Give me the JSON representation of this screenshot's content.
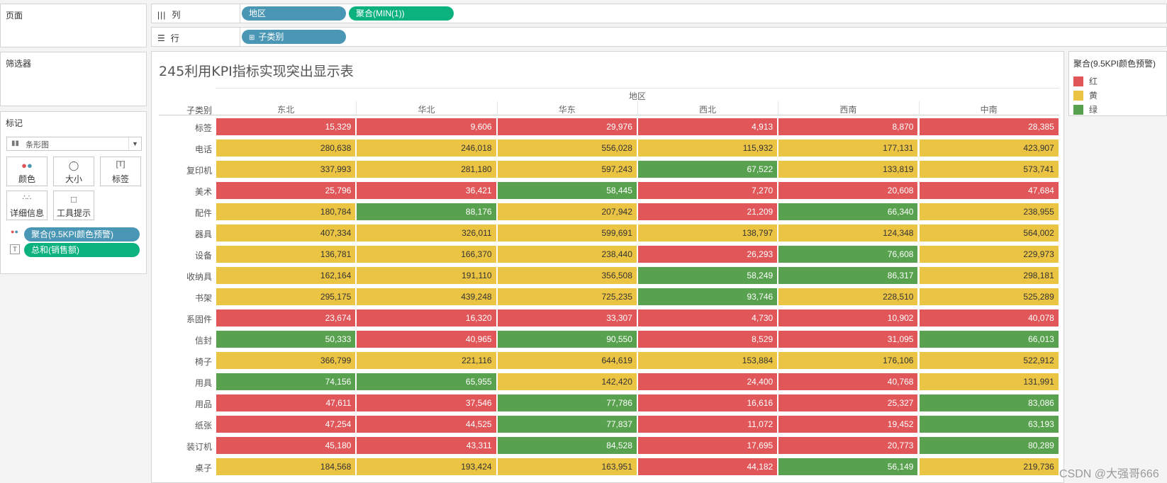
{
  "shelves": {
    "pages_label": "页面",
    "columns_label": "列",
    "rows_label": "行",
    "column_pills": [
      "地区",
      "聚合(MIN(1))"
    ],
    "row_pill": "子类别"
  },
  "filters": {
    "label": "筛选器"
  },
  "marks": {
    "label": "标记",
    "type_select": "条形图",
    "buttons": [
      "颜色",
      "大小",
      "标签",
      "详细信息",
      "工具提示"
    ],
    "fields": [
      "聚合(9.5KPI颜色预警)",
      "总和(销售额)"
    ]
  },
  "view": {
    "title": "245利用KPI指标实现突出显示表",
    "column_header": "地区",
    "row_header": "子类别"
  },
  "legend": {
    "title": "聚合(9.5KPI颜色预警)",
    "items": [
      {
        "label": "红",
        "color": "#e05659"
      },
      {
        "label": "黄",
        "color": "#ecc443"
      },
      {
        "label": "绿",
        "color": "#58a14e"
      }
    ]
  },
  "watermark": "CSDN @大强哥666",
  "table": {
    "columns": [
      "东北",
      "华北",
      "华东",
      "西北",
      "西南",
      "中南"
    ],
    "rows": [
      {
        "label": "标签",
        "values": [
          "15,329",
          "9,606",
          "29,976",
          "4,913",
          "8,870",
          "28,385"
        ],
        "colors": [
          "红",
          "红",
          "红",
          "红",
          "红",
          "红"
        ]
      },
      {
        "label": "电话",
        "values": [
          "280,638",
          "246,018",
          "556,028",
          "115,932",
          "177,131",
          "423,907"
        ],
        "colors": [
          "黄",
          "黄",
          "黄",
          "黄",
          "黄",
          "黄"
        ]
      },
      {
        "label": "复印机",
        "values": [
          "337,993",
          "281,180",
          "597,243",
          "67,522",
          "133,819",
          "573,741"
        ],
        "colors": [
          "黄",
          "黄",
          "黄",
          "绿",
          "黄",
          "黄"
        ]
      },
      {
        "label": "美术",
        "values": [
          "25,796",
          "36,421",
          "58,445",
          "7,270",
          "20,608",
          "47,684"
        ],
        "colors": [
          "红",
          "红",
          "绿",
          "红",
          "红",
          "红"
        ]
      },
      {
        "label": "配件",
        "values": [
          "180,784",
          "88,176",
          "207,942",
          "21,209",
          "66,340",
          "238,955"
        ],
        "colors": [
          "黄",
          "绿",
          "黄",
          "红",
          "绿",
          "黄"
        ]
      },
      {
        "label": "器具",
        "values": [
          "407,334",
          "326,011",
          "599,691",
          "138,797",
          "124,348",
          "564,002"
        ],
        "colors": [
          "黄",
          "黄",
          "黄",
          "黄",
          "黄",
          "黄"
        ]
      },
      {
        "label": "设备",
        "values": [
          "136,781",
          "166,370",
          "238,440",
          "26,293",
          "76,608",
          "229,973"
        ],
        "colors": [
          "黄",
          "黄",
          "黄",
          "红",
          "绿",
          "黄"
        ]
      },
      {
        "label": "收纳具",
        "values": [
          "162,164",
          "191,110",
          "356,508",
          "58,249",
          "86,317",
          "298,181"
        ],
        "colors": [
          "黄",
          "黄",
          "黄",
          "绿",
          "绿",
          "黄"
        ]
      },
      {
        "label": "书架",
        "values": [
          "295,175",
          "439,248",
          "725,235",
          "93,746",
          "228,510",
          "525,289"
        ],
        "colors": [
          "黄",
          "黄",
          "黄",
          "绿",
          "黄",
          "黄"
        ]
      },
      {
        "label": "系固件",
        "values": [
          "23,674",
          "16,320",
          "33,307",
          "4,730",
          "10,902",
          "40,078"
        ],
        "colors": [
          "红",
          "红",
          "红",
          "红",
          "红",
          "红"
        ]
      },
      {
        "label": "信封",
        "values": [
          "50,333",
          "40,965",
          "90,550",
          "8,529",
          "31,095",
          "66,013"
        ],
        "colors": [
          "绿",
          "红",
          "绿",
          "红",
          "红",
          "绿"
        ]
      },
      {
        "label": "椅子",
        "values": [
          "366,799",
          "221,116",
          "644,619",
          "153,884",
          "176,106",
          "522,912"
        ],
        "colors": [
          "黄",
          "黄",
          "黄",
          "黄",
          "黄",
          "黄"
        ]
      },
      {
        "label": "用具",
        "values": [
          "74,156",
          "65,955",
          "142,420",
          "24,400",
          "40,768",
          "131,991"
        ],
        "colors": [
          "绿",
          "绿",
          "黄",
          "红",
          "红",
          "黄"
        ]
      },
      {
        "label": "用品",
        "values": [
          "47,611",
          "37,546",
          "77,786",
          "16,616",
          "25,327",
          "83,086"
        ],
        "colors": [
          "红",
          "红",
          "绿",
          "红",
          "红",
          "绿"
        ]
      },
      {
        "label": "纸张",
        "values": [
          "47,254",
          "44,525",
          "77,837",
          "11,072",
          "19,452",
          "63,193"
        ],
        "colors": [
          "红",
          "红",
          "绿",
          "红",
          "红",
          "绿"
        ]
      },
      {
        "label": "装订机",
        "values": [
          "45,180",
          "43,311",
          "84,528",
          "17,695",
          "20,773",
          "80,289"
        ],
        "colors": [
          "红",
          "红",
          "绿",
          "红",
          "红",
          "绿"
        ]
      },
      {
        "label": "桌子",
        "values": [
          "184,568",
          "193,424",
          "163,951",
          "44,182",
          "56,149",
          "219,736"
        ],
        "colors": [
          "黄",
          "黄",
          "黄",
          "红",
          "绿",
          "黄"
        ]
      }
    ]
  }
}
